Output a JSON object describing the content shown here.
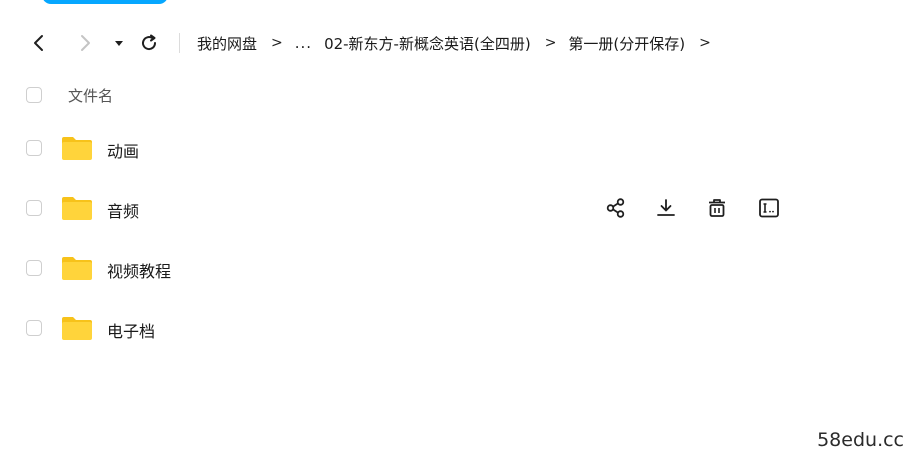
{
  "colors": {
    "accent": "#06a7ff",
    "folder": "#ffd43b",
    "folder_tab": "#f7c21a"
  },
  "toolbar": {
    "icons": [
      "back-icon",
      "forward-icon",
      "dropdown-caret-icon",
      "refresh-icon"
    ]
  },
  "breadcrumb": {
    "items": [
      {
        "label": "我的网盘"
      },
      {
        "label": "02-新东方-新概念英语(全四册)"
      },
      {
        "label": "第一册(分开保存)"
      }
    ],
    "ellipsis": "...",
    "separator": ">"
  },
  "table": {
    "column_name": "文件名",
    "rows": [
      {
        "name": "动画",
        "icon": "folder-icon"
      },
      {
        "name": "音频",
        "icon": "folder-icon",
        "hover_actions": [
          "share-icon",
          "download-icon",
          "delete-icon",
          "rename-icon"
        ]
      },
      {
        "name": "视频教程",
        "icon": "folder-icon"
      },
      {
        "name": "电子档",
        "icon": "folder-icon"
      }
    ]
  },
  "watermark": "58edu.cc"
}
